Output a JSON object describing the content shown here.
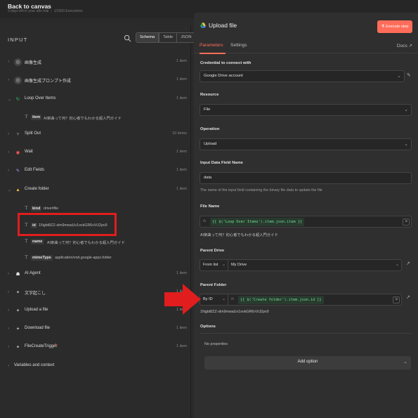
{
  "topbar": {
    "back": "Back to canvas",
    "trial": "3 days left in your n8n trial",
    "executions": "1/1000 Executions"
  },
  "input_panel": {
    "title": "INPUT",
    "modes": [
      "Schema",
      "Table",
      "JSON"
    ],
    "nodes": [
      {
        "label": "画像生成",
        "count": "1 item",
        "icon": "openai-icon"
      },
      {
        "label": "画像生成プロンプト作成",
        "count": "1 item",
        "icon": "openai-icon"
      },
      {
        "label": "Loop Over Items",
        "count": "1 item",
        "icon": "loop-icon"
      },
      {
        "label": "Split Out",
        "count": "10 items",
        "icon": "split-icon"
      },
      {
        "label": "Wait",
        "count": "1 item",
        "icon": "wait-icon"
      },
      {
        "label": "Edit Fields",
        "count": "1 item",
        "icon": "pencil-icon"
      },
      {
        "label": "Create folder",
        "count": "1 item",
        "icon": "drive-icon"
      },
      {
        "label": "AI Agent",
        "count": "1 item",
        "icon": "robot-icon"
      },
      {
        "label": "文字起こし",
        "count": "1 item",
        "icon": "openai-icon"
      },
      {
        "label": "Upload a file",
        "count": "1 item",
        "icon": "drive-icon"
      },
      {
        "label": "Download file",
        "count": "1 item",
        "icon": "drive-icon"
      },
      {
        "label": "FileCreateTrigger",
        "count": "1 item",
        "icon": "drive-icon"
      }
    ],
    "loop_fields": [
      {
        "key": "item",
        "value": "AI楽曲って何？初心者でもわかる超入門ガイド"
      }
    ],
    "folder_fields": [
      {
        "key": "kind",
        "value": "drive#file"
      },
      {
        "key": "id",
        "value": "1Ngbt8ZZ-slm9mwaUv1ovkGR6vViJ2pv9"
      },
      {
        "key": "name",
        "value": "AI楽曲って何？初心者でもわかる超入門ガイド"
      },
      {
        "key": "mimeType",
        "value": "application/vnd.google-apps.folder"
      }
    ],
    "variables": "Variables and context"
  },
  "node_panel": {
    "title": "Upload file",
    "execute": "Execute step",
    "tabs": [
      "Parameters",
      "Settings"
    ],
    "docs": "Docs",
    "credential_label": "Credential to connect with",
    "credential_value": "Google Drive account",
    "resource_label": "Resource",
    "resource_value": "File",
    "operation_label": "Operation",
    "operation_value": "Upload",
    "input_field_label": "Input Data Field Name",
    "input_field_value": "data",
    "input_field_hint": "The name of the input field containing the binary file data to update the file",
    "file_name_label": "File Name",
    "file_name_expr": "{{ $('Loop Over Items').item.json.item }}",
    "file_name_preview": "AI楽曲って何？初心者でもわかる超入門ガイド",
    "parent_drive_label": "Parent Drive",
    "parent_drive_mode": "From list",
    "parent_drive_value": "My Drive",
    "parent_folder_label": "Parent Folder",
    "parent_folder_mode": "By ID",
    "parent_folder_expr": "{{ $('Create folder').item.json.id }}",
    "parent_folder_preview": "1Ngbt8ZZ-slm9mwaUv1ovkGR6vViJ2pv9",
    "options_label": "Options",
    "no_properties": "No properties",
    "add_option": "Add option"
  },
  "colors": {
    "accent": "#ff6d5a",
    "highlight": "#e11d1d",
    "expr_green": "#6ee08f"
  }
}
